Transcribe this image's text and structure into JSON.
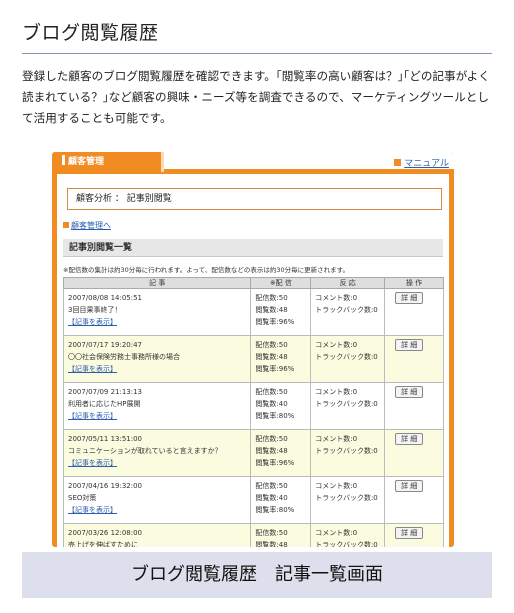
{
  "page": {
    "title": "ブログ閲覧履歴",
    "intro": "登録した顧客のブログ閲覧履歴を確認できます。｢閲覧率の高い顧客は？｣｢どの記事がよく読まれている？｣など顧客の興味・ニーズ等を調査できるので、マーケティングツールとして活用することも可能です。",
    "caption": "ブログ閲覧履歴　記事一覧画面"
  },
  "app": {
    "header": "顧客管理",
    "manual_link": "マニュアル",
    "analysis_title": "顧客分析 ： 記事別閲覧",
    "back_link": "顧客管理へ",
    "section_title": "記事別閲覧一覧",
    "note": "※配信数の集計は約30分毎に行われます。よって、配信数などの表示は約30分毎に更新されます。",
    "columns": [
      "記 事",
      "※配 信",
      "反 応",
      "操 作"
    ],
    "detail_label": "詳 細",
    "show_article": "【記事を表示】",
    "rows": [
      {
        "date": "2007/08/08 14:05:51",
        "title": "3回目果事終了！",
        "delivered": "配信数:50",
        "views": "閲覧数:48",
        "rate": "閲覧率:96%",
        "comments": "コメント数:0",
        "trackbacks": "トラックバック数:0"
      },
      {
        "date": "2007/07/17 19:20:47",
        "title": "〇〇社会保険労務士事務所様の場合",
        "delivered": "配信数:50",
        "views": "閲覧数:48",
        "rate": "閲覧率:96%",
        "comments": "コメント数:0",
        "trackbacks": "トラックバック数:0"
      },
      {
        "date": "2007/07/09 21:13:13",
        "title": "利用者に応じたHP展開",
        "delivered": "配信数:50",
        "views": "閲覧数:40",
        "rate": "閲覧率:80%",
        "comments": "コメント数:0",
        "trackbacks": "トラックバック数:0"
      },
      {
        "date": "2007/05/11 13:51:00",
        "title": "コミュニケーションが取れていると言えますか？",
        "delivered": "配信数:50",
        "views": "閲覧数:48",
        "rate": "閲覧率:96%",
        "comments": "コメント数:0",
        "trackbacks": "トラックバック数:0"
      },
      {
        "date": "2007/04/16 19:32:00",
        "title": "SEO対策",
        "delivered": "配信数:50",
        "views": "閲覧数:40",
        "rate": "閲覧率:80%",
        "comments": "コメント数:0",
        "trackbacks": "トラックバック数:0"
      },
      {
        "date": "2007/03/26 12:08:00",
        "title": "売上げを伸ばすために",
        "delivered": "配信数:50",
        "views": "閲覧数:48",
        "rate": "",
        "comments": "コメント数:0",
        "trackbacks": "トラックバック数:0"
      }
    ]
  },
  "colors": {
    "accent": "#f08c22",
    "link": "#2a5cb0",
    "caption_bg": "#dde0ec",
    "alt_row": "#fbfbe0"
  }
}
